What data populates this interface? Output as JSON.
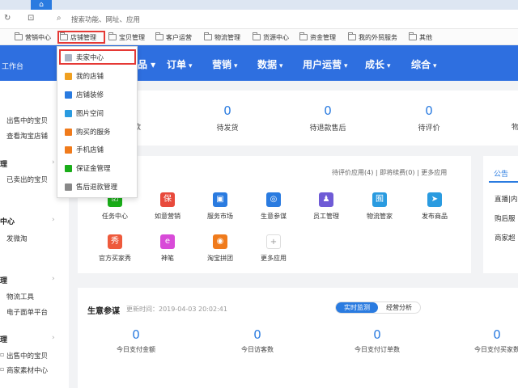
{
  "browser": {
    "addr_placeholder": "搜索功能、网址、应用",
    "bookmarks": [
      "营销中心",
      "店铺管理",
      "宝贝管理",
      "客户运营",
      "物流管理",
      "货源中心",
      "资金管理",
      "我的外贸服务",
      "其他"
    ]
  },
  "nav": {
    "workbench": "工作台",
    "items": [
      "订单",
      "营销",
      "数据",
      "用户运营",
      "成长",
      "综合"
    ]
  },
  "sidebar": {
    "items": [
      {
        "text": "出售中的宝贝",
        "type": "link"
      },
      {
        "text": "查看淘宝店铺",
        "type": "link"
      },
      {
        "text": "理",
        "type": "head"
      },
      {
        "text": "已卖出的宝贝",
        "type": "link"
      },
      {
        "text": "中心",
        "type": "head"
      },
      {
        "text": "发微淘",
        "type": "link"
      },
      {
        "text": "理",
        "type": "head"
      },
      {
        "text": "物流工具",
        "type": "link"
      },
      {
        "text": "电子面单平台",
        "type": "link"
      },
      {
        "text": "理",
        "type": "head"
      },
      {
        "text": "出售中的宝贝",
        "type": "link"
      },
      {
        "text": "商家素材中心",
        "type": "link"
      }
    ]
  },
  "stats": [
    {
      "value": "0",
      "label": "待发货"
    },
    {
      "value": "0",
      "label": "待退款售后"
    },
    {
      "value": "0",
      "label": "待评价"
    }
  ],
  "apps": {
    "links": "待评价应用(4)  |  即将续费(0)  |  更多应用",
    "items": [
      {
        "label": "任务中心",
        "color": "#1aad19",
        "glyph": "☑"
      },
      {
        "label": "如意营销",
        "color": "#e84a3c",
        "glyph": "保"
      },
      {
        "label": "服务市场",
        "color": "#2a7be0",
        "glyph": "▣"
      },
      {
        "label": "生意参谋",
        "color": "#2a7be0",
        "glyph": "◎"
      },
      {
        "label": "员工管理",
        "color": "#6f5bd6",
        "glyph": "♟"
      },
      {
        "label": "物流管家",
        "color": "#2a9be0",
        "glyph": "囿"
      },
      {
        "label": "发布商品",
        "color": "#2a9be0",
        "glyph": "➤"
      },
      {
        "label": "官方买家秀",
        "color": "#ee5a3c",
        "glyph": "秀"
      },
      {
        "label": "神笔",
        "color": "#d84bd8",
        "glyph": "e"
      },
      {
        "label": "淘宝拼团",
        "color": "#f07b1c",
        "glyph": "◉"
      },
      {
        "label": "更多应用",
        "color": "#ffffff",
        "glyph": "+"
      }
    ]
  },
  "notice": {
    "tab": "公告",
    "lines": [
      "直播|内",
      "购后服",
      "商家超"
    ]
  },
  "biz": {
    "title": "生意参谋",
    "updated": "更新时间：2019-04-03 20:02:41",
    "tab_active": "实时监测",
    "tab_other": "经营分析",
    "metrics": [
      {
        "value": "0",
        "label": "今日支付金额"
      },
      {
        "value": "0",
        "label": "今日访客数"
      },
      {
        "value": "0",
        "label": "今日支付订单数"
      },
      {
        "value": "0",
        "label": "今日支付买家数"
      }
    ]
  },
  "dropdown": {
    "items": [
      {
        "label": "卖家中心",
        "color": "#aab4c4"
      },
      {
        "label": "我的店铺",
        "color": "#f0a020"
      },
      {
        "label": "店铺装修",
        "color": "#2a7be0"
      },
      {
        "label": "图片空间",
        "color": "#2a9be0"
      },
      {
        "label": "购买的服务",
        "color": "#f07b1c"
      },
      {
        "label": "手机店铺",
        "color": "#f07b1c"
      },
      {
        "label": "保证金管理",
        "color": "#1aad19"
      },
      {
        "label": "售后退款管理",
        "color": "#888888"
      }
    ]
  }
}
